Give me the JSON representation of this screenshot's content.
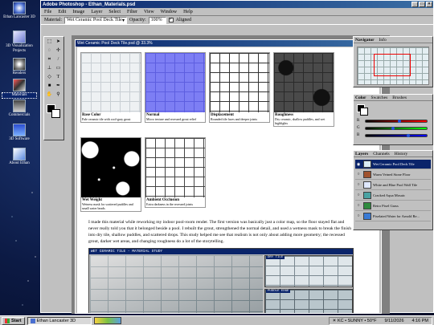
{
  "desktop": {
    "icons": [
      {
        "label": "Ethan Lancaster 3D",
        "icon": "logo-icon"
      },
      {
        "label": "3D Visualization Projects",
        "icon": "folder-icon"
      },
      {
        "label": "Renders",
        "icon": "render-icon"
      },
      {
        "label": "Materials",
        "icon": "materials-icon"
      },
      {
        "label": "Commercials",
        "icon": "film-icon"
      },
      {
        "label": "3D Software",
        "icon": "monitor-icon"
      },
      {
        "label": "About Ethan",
        "icon": "help-icon"
      }
    ]
  },
  "window": {
    "title": "Adobe Photoshop - Ethan_Materials.psd",
    "menu": [
      "File",
      "Edit",
      "Image",
      "Layer",
      "Select",
      "Filter",
      "View",
      "Window",
      "Help"
    ],
    "options": {
      "material_label": "Material:",
      "material_value": "Wet Ceramic Pool Deck Tile",
      "opacity_label": "Opacity:",
      "opacity_value": "100%",
      "aligned_label": "Aligned"
    }
  },
  "document": {
    "title": "Wet Ceramic Pool Deck Tile.psd @ 33.3%",
    "maps": [
      {
        "name": "Base Color",
        "desc": "Pale ceramic tile with cool-gray grout"
      },
      {
        "name": "Normal",
        "desc": "Micro texture and recessed grout relief"
      },
      {
        "name": "Displacement",
        "desc": "Rounded tile faces and deeper joints"
      },
      {
        "name": "Roughness",
        "desc": "Dry ceramic, shallow puddles, and wet highlights"
      },
      {
        "name": "Wet Weight",
        "desc": "Wetness mask for scattered puddles and small water beads"
      },
      {
        "name": "Ambient Occlusion",
        "desc": "Extra darkness in the recessed joints"
      }
    ],
    "paragraph": "I made this material while reworking my indoor pool-room render. The first version was basically just a color map, so the floor stayed flat and never really told you that it belonged beside a pool. I rebuilt the grout, strengthened the normal detail, and used a wetness mask to break the finish into dry tile, shallow puddles, and scattered drops. This study helped me see that realism is not only about adding more geometry; the recessed grout, darker wet areas, and changing roughness do a lot of the storytelling.",
    "study": {
      "title": "WET CERAMIC TILE - MATERIAL STUDY",
      "inset1": "DRY TILE",
      "inset2": "PUDDLE EDGE"
    }
  },
  "panels": {
    "navigator": {
      "tabs": [
        "Navigator",
        "Info"
      ]
    },
    "color": {
      "tabs": [
        "Color",
        "Swatches",
        "Brushes"
      ],
      "channels": [
        "R",
        "G",
        "B"
      ],
      "levels": [
        0.55,
        0.45,
        0.7
      ]
    },
    "layers": {
      "tabs": [
        "Layers",
        "Channels",
        "History"
      ],
      "items": [
        {
          "name": "Wet Ceramic Pool Deck Tile",
          "active": true,
          "color": "#d9ecf6"
        },
        {
          "name": "Warm Veined Stone Floor",
          "active": false,
          "color": "#a0522d"
        },
        {
          "name": "White and Blue Pool Wall Tile",
          "active": false,
          "color": "#dfe8ff"
        },
        {
          "name": "Cracked Aqua Mosaic",
          "active": false,
          "color": "#4aa3a3"
        },
        {
          "name": "Retro Pixel Grass",
          "active": false,
          "color": "#2e8b3e"
        },
        {
          "name": "Pixelated Water for Arnold Re...",
          "active": false,
          "color": "#3a7bd5"
        }
      ]
    }
  },
  "taskbar": {
    "start": "Start",
    "task": "Ethan Lancaster 3D",
    "weather": "KC • SUNNY • 50°F",
    "date": "9/11/2026",
    "time": "4:16 PM"
  },
  "colors": {
    "titlebar": "#0a246a",
    "face": "#c0c0c0",
    "desktop": "#0c1a44"
  }
}
